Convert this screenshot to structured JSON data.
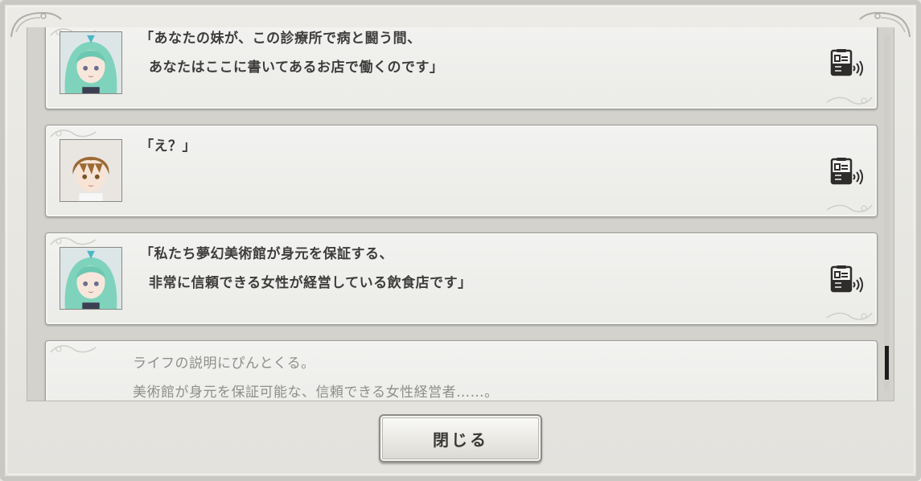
{
  "dialog": {
    "close_label": "閉じる"
  },
  "log_entries": [
    {
      "type": "speech",
      "speaker": "green-haired-girl",
      "line1": "「あなたの妹が、この診療所で病と闘う間、",
      "line2": "あなたはここに書いてあるお店で働くのです」",
      "voice_icon": "voice-replay-icon"
    },
    {
      "type": "speech",
      "speaker": "brown-haired-boy",
      "line1": "「え？」",
      "line2": "",
      "voice_icon": "voice-replay-icon"
    },
    {
      "type": "speech",
      "speaker": "green-haired-girl",
      "line1": "「私たち夢幻美術館が身元を保証する、",
      "line2": "非常に信頼できる女性が経営している飲食店です」",
      "voice_icon": "voice-replay-icon"
    },
    {
      "type": "narration",
      "line1": "ライフの説明にぴんとくる。",
      "line2": "美術館が身元を保証可能な、信頼できる女性経営者……。"
    }
  ],
  "colors": {
    "frame": "#c9c8c2",
    "panel": "#d3d2cd",
    "entry_bg": "#efefec",
    "speech_text": "#3e3d3b",
    "narration_text": "#8f8e8a",
    "scroll_thumb": "#1c1c1c"
  }
}
